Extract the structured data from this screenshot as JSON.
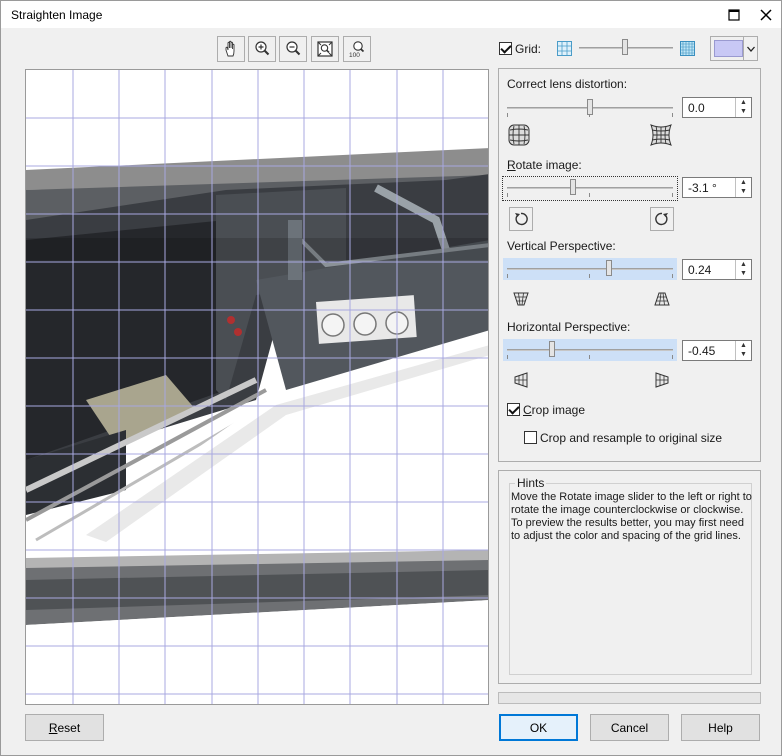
{
  "window": {
    "title": "Straighten Image"
  },
  "toolbar": {
    "tools": [
      {
        "name": "pan-tool",
        "icon": "hand-icon"
      },
      {
        "name": "zoom-in-tool",
        "icon": "zoom-in-icon"
      },
      {
        "name": "zoom-out-tool",
        "icon": "zoom-out-icon"
      },
      {
        "name": "fit-tool",
        "icon": "fit-to-window-icon"
      },
      {
        "name": "actual-size-tool",
        "icon": "zoom-100-icon",
        "label": "100"
      }
    ]
  },
  "grid": {
    "label": "Grid:",
    "checked": true,
    "color": "#c8c8f5"
  },
  "lens": {
    "label": "Correct lens distortion:",
    "value": "0.0"
  },
  "rotate": {
    "label": "Rotate image:",
    "value": "-3.1 °"
  },
  "vertical": {
    "label": "Vertical Perspective:",
    "value": "0.24"
  },
  "horizontal": {
    "label": "Horizontal Perspective:",
    "value": "-0.45"
  },
  "crop": {
    "label": "Crop image",
    "checked": true
  },
  "resample": {
    "label": "Crop and resample to original size",
    "checked": false
  },
  "hints": {
    "title": "Hints",
    "text": "Move the Rotate image slider to the left or right to rotate the image counterclockwise or clockwise. To preview the results better, you may first need to adjust the color and spacing of the grid lines."
  },
  "buttons": {
    "reset": "Reset",
    "ok": "OK",
    "cancel": "Cancel",
    "help": "Help"
  },
  "colors": {
    "accent": "#0078d7",
    "grid_line": "#a8a8e0",
    "slider_highlight": "#cde0f7"
  }
}
